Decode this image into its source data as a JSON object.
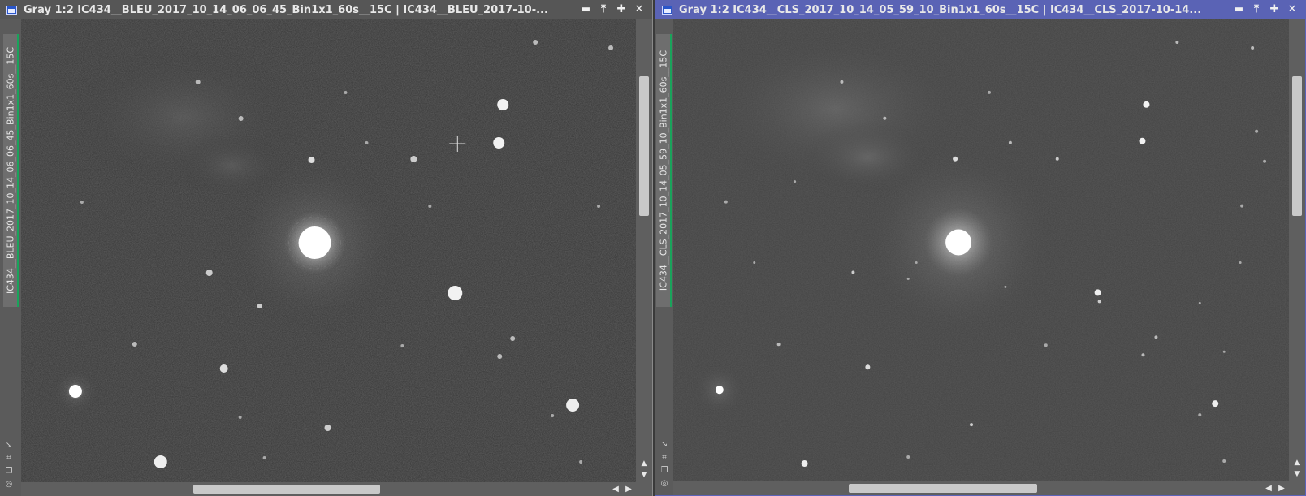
{
  "windows": [
    {
      "id": "left",
      "title": "Gray 1:2 IC434__BLEU_2017_10_14_06_06_45_Bin1x1_60s__15C | IC434__BLEU_2017-10-...",
      "side_label": "IC434__BLEU_2017_10_14_06_06_45_Bin1x1_60s__15C",
      "buttons": [
        "minimize",
        "shade",
        "maximize",
        "close"
      ],
      "active": false
    },
    {
      "id": "right",
      "title": "Gray 1:2 IC434__CLS_2017_10_14_05_59_10_Bin1x1_60s__15C | IC434__CLS_2017-10-14...",
      "side_label": "IC434__CLS_2017_10_14_05_59_10_Bin1x1_60s__15C",
      "buttons": [
        "minimize",
        "shade",
        "maximize",
        "close"
      ],
      "active": true
    }
  ],
  "icons": {
    "title_buttons": [
      "minimize-icon",
      "shade-icon",
      "maximize-icon",
      "close-icon"
    ],
    "side_tools": [
      "fit-view-icon",
      "zoom-icon",
      "clone-icon",
      "settings-icon"
    ]
  },
  "colors": {
    "active_title": "#5a63b5",
    "inactive_title": "#565656",
    "side_tab_accent": "#1aa35b"
  }
}
